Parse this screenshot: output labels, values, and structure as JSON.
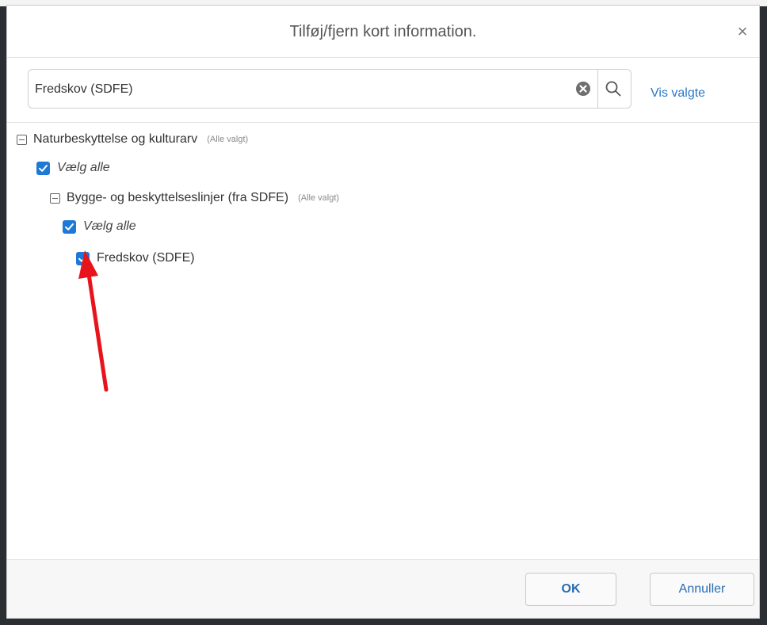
{
  "dialog": {
    "title": "Tilføj/fjern kort information.",
    "close_symbol": "×"
  },
  "search": {
    "value": "Fredskov (SDFE)",
    "show_selected_link": "Vis valgte"
  },
  "tree": {
    "group": {
      "label": "Naturbeskyttelse og kulturarv",
      "status": "(Alle valgt)",
      "select_all": "Vælg alle"
    },
    "subgroup": {
      "label": "Bygge- og beskyttelseslinjer (fra SDFE)",
      "status": "(Alle valgt)",
      "select_all": "Vælg alle"
    },
    "item": {
      "label": "Fredskov (SDFE)"
    }
  },
  "footer": {
    "ok_label": "OK",
    "cancel_label": "Annuller"
  },
  "icons": {
    "close": "close-icon",
    "clear": "clear-icon",
    "search": "search-icon",
    "checkbox_checked": "checkmark-icon",
    "collapse": "minus-box-icon",
    "annotation_arrow": "red-arrow-icon"
  },
  "colors": {
    "accent": "#1d78d6",
    "link": "#2a77c9",
    "arrow": "#e8141b"
  }
}
